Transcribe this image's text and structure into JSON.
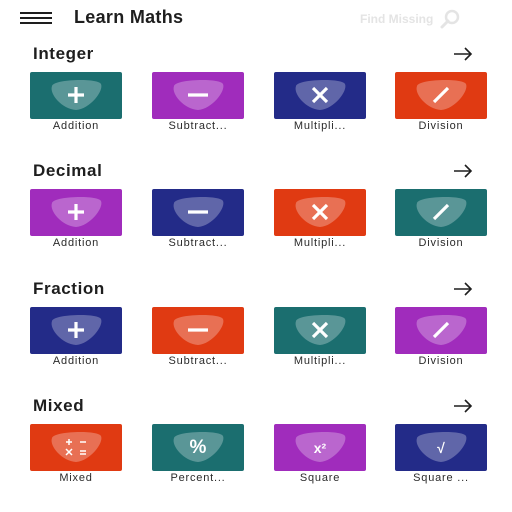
{
  "app": {
    "title": "Learn Maths",
    "find_missing": "Find Missing"
  },
  "colors": {
    "teal": "#1b6e6f",
    "purple": "#a02cbc",
    "navy": "#232b88",
    "red": "#e03a12"
  },
  "sections": [
    {
      "title": "Integer",
      "tiles": [
        {
          "label": "Addition",
          "icon": "plus-icon",
          "color": "#1b6e6f"
        },
        {
          "label": "Subtract...",
          "icon": "minus-icon",
          "color": "#a02cbc"
        },
        {
          "label": "Multipli...",
          "icon": "times-icon",
          "color": "#232b88"
        },
        {
          "label": "Division",
          "icon": "divide-icon",
          "color": "#e03a12"
        }
      ]
    },
    {
      "title": "Decimal",
      "tiles": [
        {
          "label": "Addition",
          "icon": "plus-icon",
          "color": "#a02cbc"
        },
        {
          "label": "Subtract...",
          "icon": "minus-icon",
          "color": "#232b88"
        },
        {
          "label": "Multipli...",
          "icon": "times-icon",
          "color": "#e03a12"
        },
        {
          "label": "Division",
          "icon": "divide-icon",
          "color": "#1b6e6f"
        }
      ]
    },
    {
      "title": "Fraction",
      "tiles": [
        {
          "label": "Addition",
          "icon": "plus-icon",
          "color": "#232b88"
        },
        {
          "label": "Subtract...",
          "icon": "minus-icon",
          "color": "#e03a12"
        },
        {
          "label": "Multipli...",
          "icon": "times-icon",
          "color": "#1b6e6f"
        },
        {
          "label": "Division",
          "icon": "divide-icon",
          "color": "#a02cbc"
        }
      ]
    },
    {
      "title": "Mixed",
      "tiles": [
        {
          "label": "Mixed",
          "icon": "mixed-operators-icon",
          "color": "#e03a12"
        },
        {
          "label": "Percent...",
          "icon": "percent-icon",
          "color": "#1b6e6f",
          "symbol": "%"
        },
        {
          "label": "Square",
          "icon": "square-icon",
          "color": "#a02cbc",
          "symbol": "x²"
        },
        {
          "label": "Square ...",
          "icon": "square-root-icon",
          "color": "#232b88",
          "symbol": "√"
        }
      ]
    }
  ]
}
